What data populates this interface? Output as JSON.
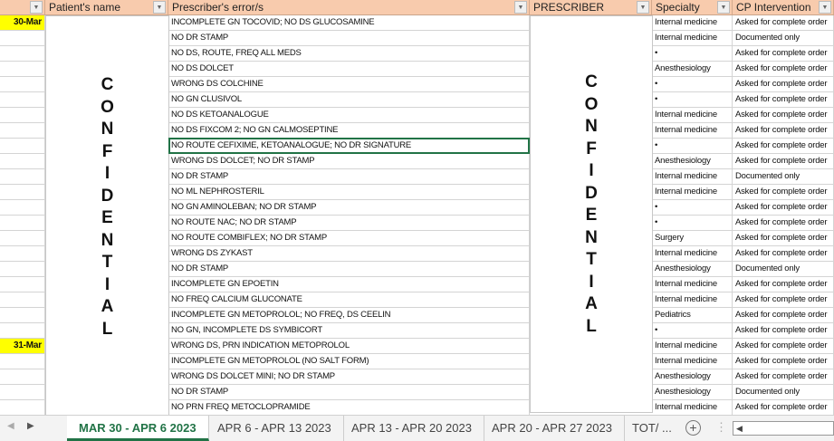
{
  "headers": {
    "date": "",
    "patient": "Patient's name",
    "errors": "Prescriber's error/s",
    "prescriber": "PRESCRIBER",
    "specialty": "Specialty",
    "intervention": "CP Intervention"
  },
  "confidential_letters": [
    "C",
    "O",
    "N",
    "F",
    "I",
    "D",
    "E",
    "N",
    "T",
    "I",
    "A",
    "L"
  ],
  "rows": [
    {
      "date": "30-Mar",
      "error": "INCOMPLETE GN TOCOVID; NO DS GLUCOSAMINE",
      "specialty": "Internal medicine",
      "intervention": "Asked for complete order"
    },
    {
      "date": "",
      "error": "NO DR STAMP",
      "specialty": "Internal medicine",
      "intervention": "Documented only"
    },
    {
      "date": "",
      "error": "NO DS, ROUTE, FREQ ALL MEDS",
      "specialty": "•",
      "intervention": "Asked for complete order"
    },
    {
      "date": "",
      "error": "NO DS DOLCET",
      "specialty": "Anesthesiology",
      "intervention": "Asked for complete order"
    },
    {
      "date": "",
      "error": "WRONG DS COLCHINE",
      "specialty": "•",
      "intervention": "Asked for complete order"
    },
    {
      "date": "",
      "error": "NO GN CLUSIVOL",
      "specialty": "•",
      "intervention": "Asked for complete order"
    },
    {
      "date": "",
      "error": "NO DS KETOANALOGUE",
      "specialty": "Internal medicine",
      "intervention": "Asked for complete order"
    },
    {
      "date": "",
      "error": "NO DS FIXCOM 2; NO GN CALMOSEPTINE",
      "specialty": "Internal medicine",
      "intervention": "Asked for complete order"
    },
    {
      "date": "",
      "error": "NO ROUTE CEFIXIME, KETOANALOGUE; NO DR SIGNATURE",
      "specialty": "•",
      "intervention": "Asked for complete order"
    },
    {
      "date": "",
      "error": "WRONG DS DOLCET; NO DR STAMP",
      "specialty": "Anesthesiology",
      "intervention": "Asked for complete order"
    },
    {
      "date": "",
      "error": "NO DR STAMP",
      "specialty": "Internal medicine",
      "intervention": "Documented only"
    },
    {
      "date": "",
      "error": "NO ML NEPHROSTERIL",
      "specialty": "Internal medicine",
      "intervention": "Asked for complete order"
    },
    {
      "date": "",
      "error": "NO GN AMINOLEBAN; NO DR STAMP",
      "specialty": "•",
      "intervention": "Asked for complete order"
    },
    {
      "date": "",
      "error": "NO ROUTE NAC; NO DR STAMP",
      "specialty": "•",
      "intervention": "Asked for complete order"
    },
    {
      "date": "",
      "error": "NO ROUTE COMBIFLEX; NO DR STAMP",
      "specialty": "Surgery",
      "intervention": "Asked for complete order"
    },
    {
      "date": "",
      "error": "WRONG DS ZYKAST",
      "specialty": "Internal medicine",
      "intervention": "Asked for complete order"
    },
    {
      "date": "",
      "error": "NO DR STAMP",
      "specialty": "Anesthesiology",
      "intervention": "Documented only"
    },
    {
      "date": "",
      "error": "INCOMPLETE GN EPOETIN",
      "specialty": "Internal medicine",
      "intervention": "Asked for complete order"
    },
    {
      "date": "",
      "error": "NO FREQ CALCIUM GLUCONATE",
      "specialty": "Internal medicine",
      "intervention": "Asked for complete order"
    },
    {
      "date": "",
      "error": "INCOMPLETE GN METOPROLOL; NO FREQ, DS CEELIN",
      "specialty": "Pediatrics",
      "intervention": "Asked for complete order"
    },
    {
      "date": "",
      "error": "NO GN, INCOMPLETE DS SYMBICORT",
      "specialty": "•",
      "intervention": "Asked for complete order"
    },
    {
      "date": "31-Mar",
      "error": "WRONG DS, PRN INDICATION METOPROLOL",
      "specialty": "Internal medicine",
      "intervention": "Asked for complete order"
    },
    {
      "date": "",
      "error": "INCOMPLETE GN METOPROLOL (NO SALT FORM)",
      "specialty": "Internal medicine",
      "intervention": "Asked for complete order"
    },
    {
      "date": "",
      "error": "WRONG DS DOLCET MINI; NO DR STAMP",
      "specialty": "Anesthesiology",
      "intervention": "Asked for complete order"
    },
    {
      "date": "",
      "error": "NO DR STAMP",
      "specialty": "Anesthesiology",
      "intervention": "Documented only"
    },
    {
      "date": "",
      "error": "NO PRN FREQ METOCLOPRAMIDE",
      "specialty": "Internal medicine",
      "intervention": "Asked for complete order"
    }
  ],
  "tabs": [
    "MAR 30 - APR 6 2023",
    "APR 6 - APR 13 2023",
    "APR 13 - APR 20 2023",
    "APR 20 - APR 27 2023",
    "TOT/ ..."
  ],
  "colors": {
    "header": "#f8cbad",
    "date_highlight": "#ffff00",
    "accent": "#217346"
  }
}
